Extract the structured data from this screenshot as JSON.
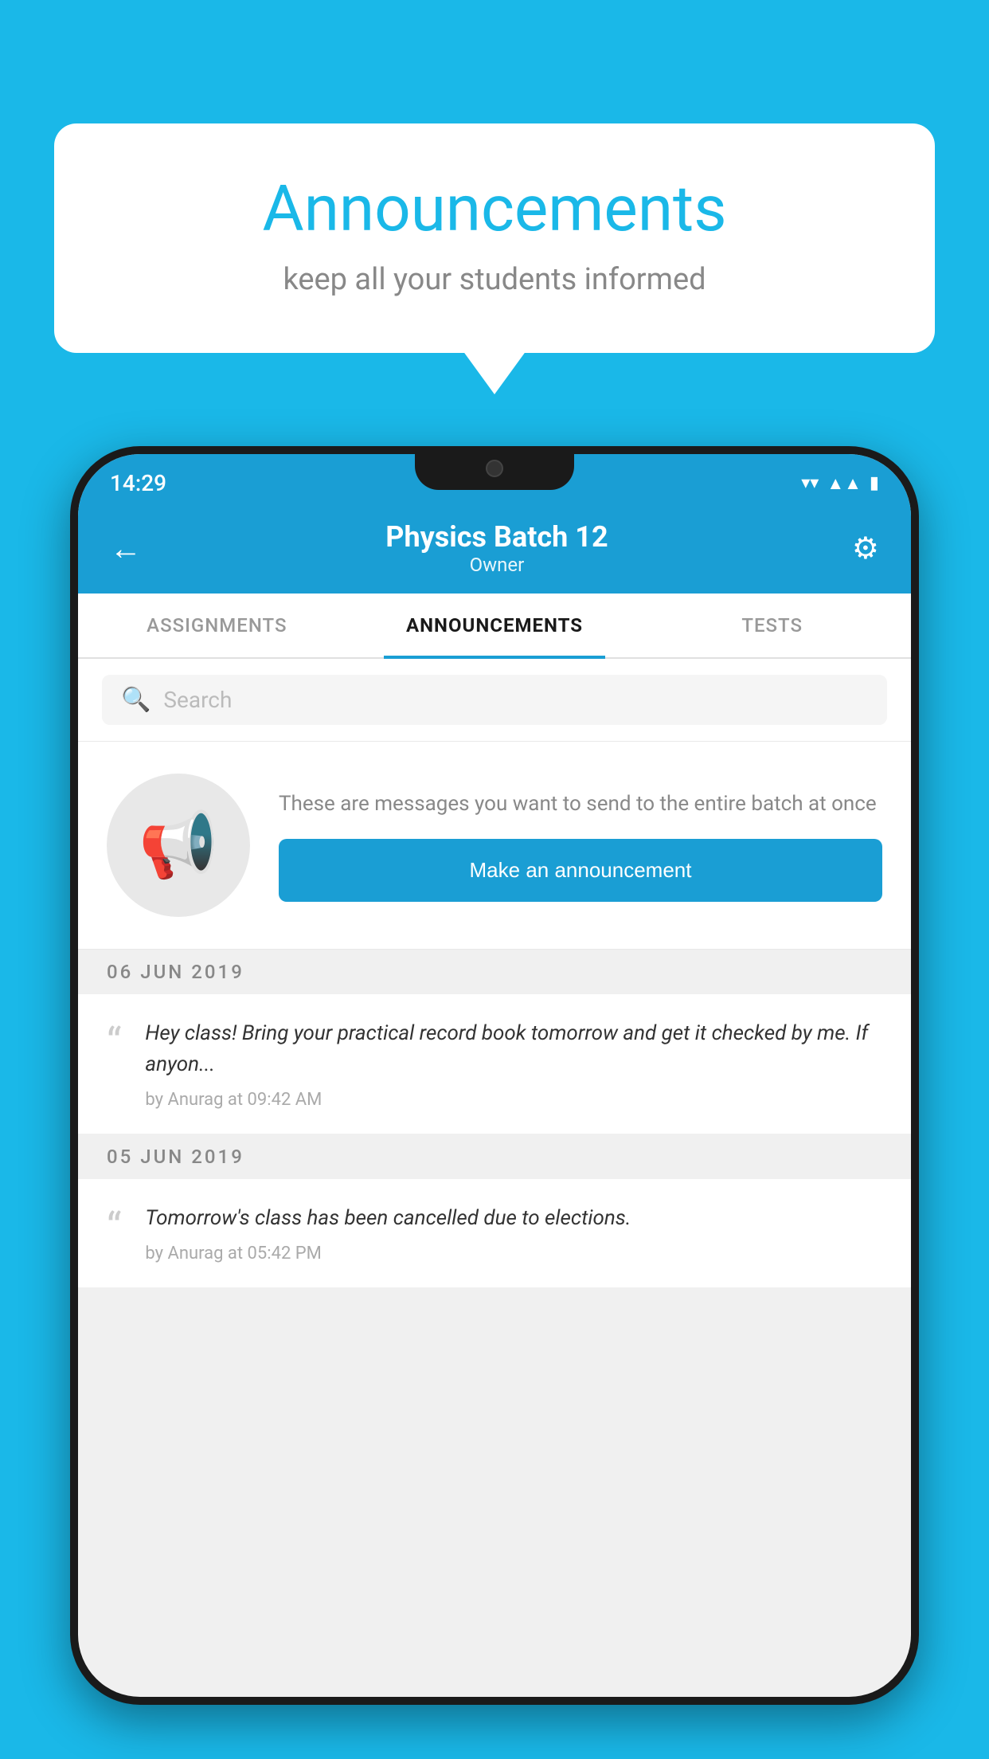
{
  "background_color": "#1ab8e8",
  "speech_bubble": {
    "title": "Announcements",
    "subtitle": "keep all your students informed"
  },
  "phone": {
    "status_bar": {
      "time": "14:29",
      "icons": [
        "wifi",
        "signal",
        "battery"
      ]
    },
    "header": {
      "title": "Physics Batch 12",
      "subtitle": "Owner",
      "back_label": "←"
    },
    "tabs": [
      {
        "label": "ASSIGNMENTS",
        "active": false
      },
      {
        "label": "ANNOUNCEMENTS",
        "active": true
      },
      {
        "label": "TESTS",
        "active": false
      }
    ],
    "search": {
      "placeholder": "Search"
    },
    "announcement_prompt": {
      "description": "These are messages you want to send to the entire batch at once",
      "button_label": "Make an announcement"
    },
    "announcements": [
      {
        "date": "06  JUN  2019",
        "text": "Hey class! Bring your practical record book tomorrow and get it checked by me. If anyon...",
        "meta": "by Anurag at 09:42 AM"
      },
      {
        "date": "05  JUN  2019",
        "text": "Tomorrow's class has been cancelled due to elections.",
        "meta": "by Anurag at 05:42 PM"
      }
    ]
  }
}
